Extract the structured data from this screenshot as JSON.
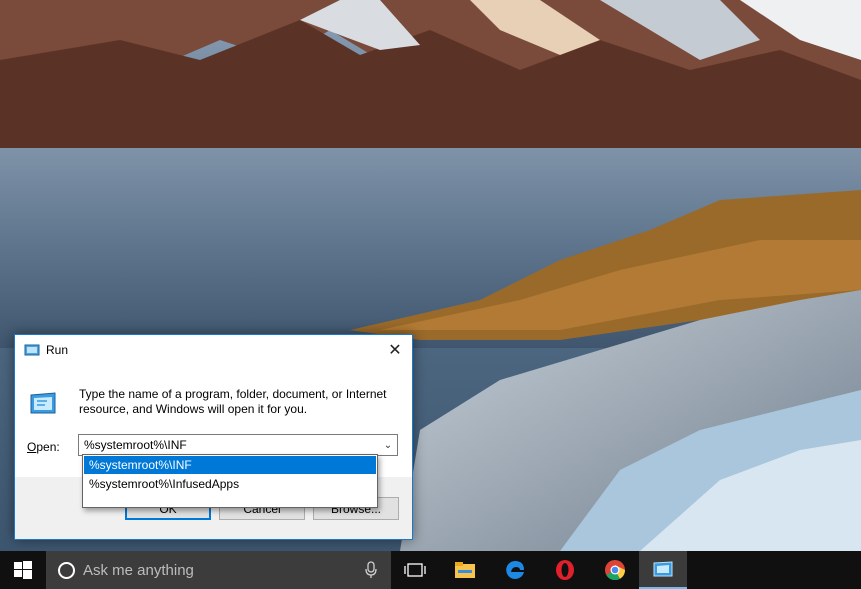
{
  "dialog": {
    "title": "Run",
    "close_glyph": "✕",
    "icon": "run-app-icon",
    "description": "Type the name of a program, folder, document, or Internet resource, and Windows will open it for you.",
    "open_label_accel": "O",
    "open_label_rest": "pen:",
    "input_value": "%systemroot%\\INF",
    "buttons": {
      "ok": "OK",
      "cancel": "Cancel",
      "browse": "Browse..."
    }
  },
  "autocomplete": {
    "items": [
      {
        "label": "%systemroot%\\INF",
        "selected": true
      },
      {
        "label": "%systemroot%\\InfusedApps",
        "selected": false
      }
    ]
  },
  "taskbar": {
    "search_placeholder": "Ask me anything",
    "icons": [
      "windows-start-icon",
      "cortana-icon",
      "microphone-icon",
      "task-view-icon",
      "file-explorer-icon",
      "edge-icon",
      "opera-icon",
      "chrome-icon",
      "run-app-icon"
    ],
    "active_color": "#76b9ed"
  },
  "colors": {
    "accent": "#0078d7",
    "dialog_border": "#1979ca",
    "taskbar": "#101010"
  }
}
